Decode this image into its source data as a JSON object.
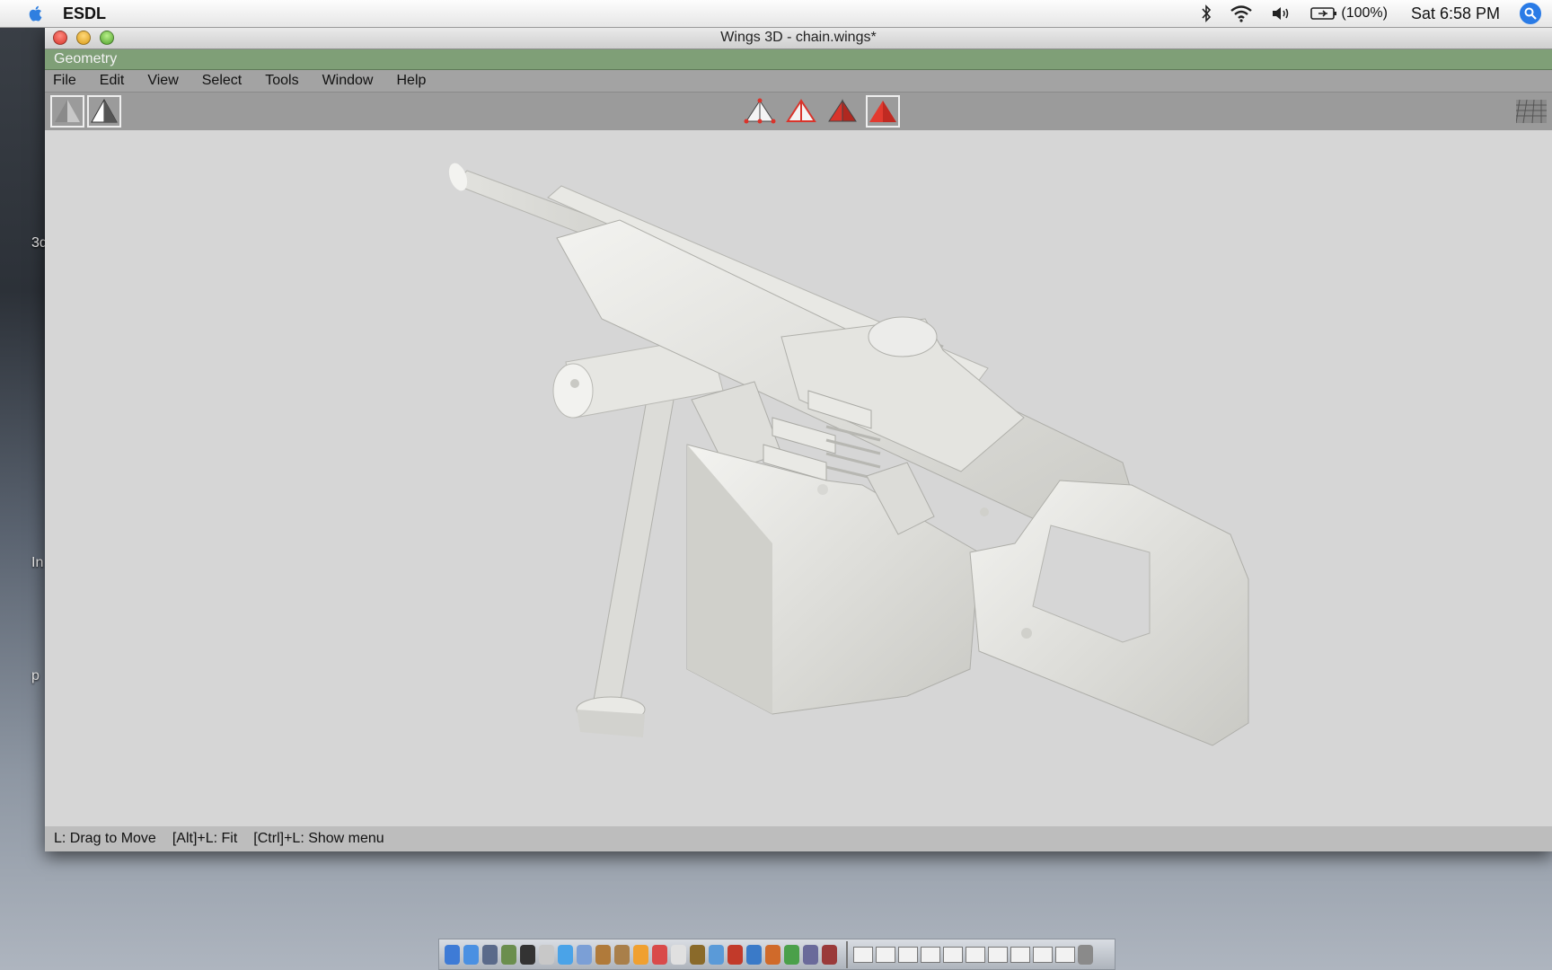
{
  "menubar": {
    "apple_icon": "apple-logo-icon",
    "app_name": "ESDL",
    "battery": "(100%)",
    "clock": "Sat 6:58 PM",
    "status_icons": [
      "bluetooth-icon",
      "wifi-icon",
      "volume-icon",
      "battery-icon",
      "spotlight-icon"
    ]
  },
  "desktop": {
    "label_1": "3d",
    "label_2": "In",
    "label_3": "p"
  },
  "window": {
    "title": "Wings 3D - chain.wings*",
    "geometry_label": "Geometry",
    "menus": [
      "File",
      "Edit",
      "View",
      "Select",
      "Tools",
      "Window",
      "Help"
    ],
    "toolbar": {
      "view_modes": [
        "smooth-shaded-icon",
        "wireframe-icon"
      ],
      "selection_modes": [
        "vertex-select-icon",
        "edge-select-icon",
        "face-select-icon",
        "body-select-icon"
      ],
      "active_selection_mode": "body-select-icon",
      "accent_color": "#d9342b"
    },
    "viewport": {
      "background": "#d6d6d6",
      "model": "chain gun model"
    },
    "status": {
      "hint_1": "L: Drag to Move",
      "hint_2": "[Alt]+L: Fit",
      "hint_3": "[Ctrl]+L: Show menu"
    }
  },
  "dock": {
    "icon_count": 22,
    "window_count": 11
  }
}
